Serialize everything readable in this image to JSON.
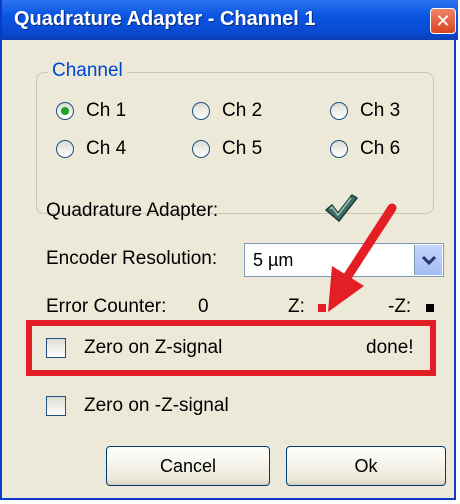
{
  "window": {
    "title": "Quadrature Adapter - Channel 1",
    "close_glyph": "✕"
  },
  "channel_group": {
    "legend": "Channel",
    "options": [
      {
        "label": "Ch 1",
        "checked": true
      },
      {
        "label": "Ch 2",
        "checked": false
      },
      {
        "label": "Ch 3",
        "checked": false
      },
      {
        "label": "Ch 4",
        "checked": false
      },
      {
        "label": "Ch 5",
        "checked": false
      },
      {
        "label": "Ch 6",
        "checked": false
      }
    ]
  },
  "quadrature": {
    "label": "Quadrature Adapter:",
    "status_icon": "checkmark-icon"
  },
  "encoder": {
    "label": "Encoder Resolution:",
    "value": "5 µm"
  },
  "error_counter": {
    "label": "Error Counter:",
    "value": "0",
    "z_label": "Z:",
    "z_color": "#e31e24",
    "nz_label": "-Z:",
    "nz_color": "#000000"
  },
  "zero_z": {
    "label": "Zero on Z-signal",
    "status": "done!",
    "checked": false
  },
  "zero_nz": {
    "label": "Zero on -Z-signal",
    "checked": false
  },
  "buttons": {
    "cancel": "Cancel",
    "ok": "Ok"
  },
  "colors": {
    "annotation_red": "#e31e24",
    "titlebar_blue": "#0a54e2"
  }
}
